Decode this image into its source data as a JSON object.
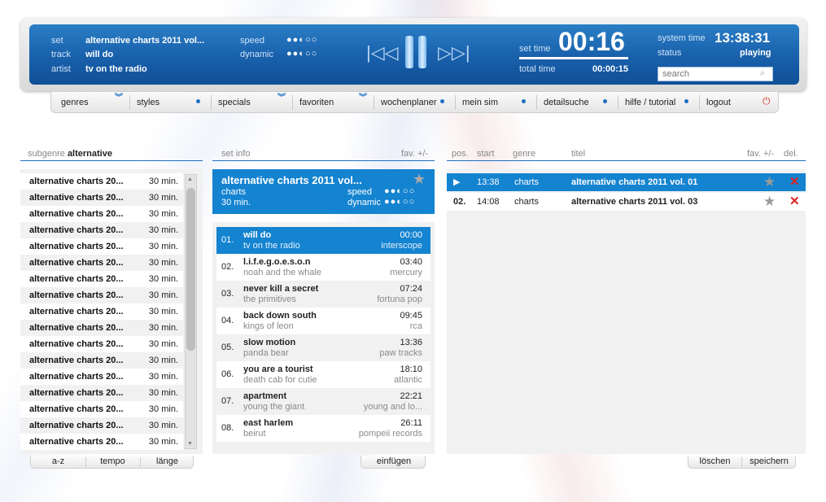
{
  "player": {
    "set_label": "set",
    "set_value": "alternative charts 2011 vol...",
    "track_label": "track",
    "track_value": "will do",
    "artist_label": "artist",
    "artist_value": "tv on the radio",
    "speed_label": "speed",
    "speed_dots": "●●◐○○",
    "dynamic_label": "dynamic",
    "dynamic_dots": "●●◐○○",
    "set_time_label": "set time",
    "set_time": "00:16",
    "total_time_label": "total time",
    "total_time": "00:00:15",
    "system_time_label": "system time",
    "system_time": "13:38:31",
    "status_label": "status",
    "status_value": "playing",
    "search_placeholder": "search",
    "prev_glyph": "|◁◁",
    "next_glyph": "▷▷|"
  },
  "nav": {
    "items": [
      "genres",
      "styles",
      "specials",
      "favoriten",
      "wochenplaner",
      "mein sim",
      "detailsuche",
      "hilfe / tutorial",
      "logout"
    ]
  },
  "subgenre": {
    "label": "subgenre",
    "value": "alternative",
    "rows": [
      {
        "title": "alternative charts 20...",
        "dur": "30 min."
      },
      {
        "title": "alternative charts 20...",
        "dur": "30 min."
      },
      {
        "title": "alternative charts 20...",
        "dur": "30 min."
      },
      {
        "title": "alternative charts 20...",
        "dur": "30 min."
      },
      {
        "title": "alternative charts 20...",
        "dur": "30 min."
      },
      {
        "title": "alternative charts 20...",
        "dur": "30 min."
      },
      {
        "title": "alternative charts 20...",
        "dur": "30 min."
      },
      {
        "title": "alternative charts 20...",
        "dur": "30 min."
      },
      {
        "title": "alternative charts 20...",
        "dur": "30 min."
      },
      {
        "title": "alternative charts 20...",
        "dur": "30 min."
      },
      {
        "title": "alternative charts 20...",
        "dur": "30 min."
      },
      {
        "title": "alternative charts 20...",
        "dur": "30 min."
      },
      {
        "title": "alternative charts 20...",
        "dur": "30 min."
      },
      {
        "title": "alternative charts 20...",
        "dur": "30 min."
      },
      {
        "title": "alternative charts 20...",
        "dur": "30 min."
      },
      {
        "title": "alternative charts 20...",
        "dur": "30 min."
      },
      {
        "title": "alternative charts 20...",
        "dur": "30 min."
      }
    ],
    "sort_buttons": [
      "a-z",
      "tempo",
      "länge"
    ]
  },
  "setinfo": {
    "heading": "set info",
    "fav_label": "fav. +/-",
    "title": "alternative charts 2011 vol...",
    "genre": "charts",
    "duration": "30 min.",
    "speed_label": "speed",
    "speed_dots": "●●◐○○",
    "dynamic_label": "dynamic",
    "dynamic_dots": "●●◐○○",
    "tracks": [
      {
        "num": "01.",
        "title": "will do",
        "artist": "tv on the radio",
        "time": "00:00",
        "label": "interscope"
      },
      {
        "num": "02.",
        "title": "l.i.f.e.g.o.e.s.o.n",
        "artist": "noah and the whale",
        "time": "03:40",
        "label": "mercury"
      },
      {
        "num": "03.",
        "title": "never kill a secret",
        "artist": "the primitives",
        "time": "07:24",
        "label": "fortuna pop"
      },
      {
        "num": "04.",
        "title": "back down south",
        "artist": "kings of leon",
        "time": "09:45",
        "label": "rca"
      },
      {
        "num": "05.",
        "title": "slow motion",
        "artist": "panda bear",
        "time": "13:36",
        "label": "paw tracks"
      },
      {
        "num": "06.",
        "title": "you are a tourist",
        "artist": "death cab for cutie",
        "time": "18:10",
        "label": "atlantic"
      },
      {
        "num": "07.",
        "title": "apartment",
        "artist": "young the giant",
        "time": "22:21",
        "label": "young and lo..."
      },
      {
        "num": "08.",
        "title": "east harlem",
        "artist": "beirut",
        "time": "26:11",
        "label": "pompeii records"
      }
    ],
    "insert_button": "einfügen"
  },
  "playlist": {
    "headers": {
      "pos": "pos.",
      "start": "start",
      "genre": "genre",
      "title": "titel",
      "fav": "fav. +/-",
      "del": "del."
    },
    "rows": [
      {
        "pos": "▶",
        "start": "13:38",
        "genre": "charts",
        "title": "alternative charts 2011 vol. 01"
      },
      {
        "pos": "02.",
        "start": "14:08",
        "genre": "charts",
        "title": "alternative charts 2011 vol. 03"
      }
    ],
    "delete_button": "löschen",
    "save_button": "speichern"
  },
  "colors": {
    "accent": "#1483d0",
    "player_blue": "#1a62ad",
    "delete_red": "#d22222"
  }
}
